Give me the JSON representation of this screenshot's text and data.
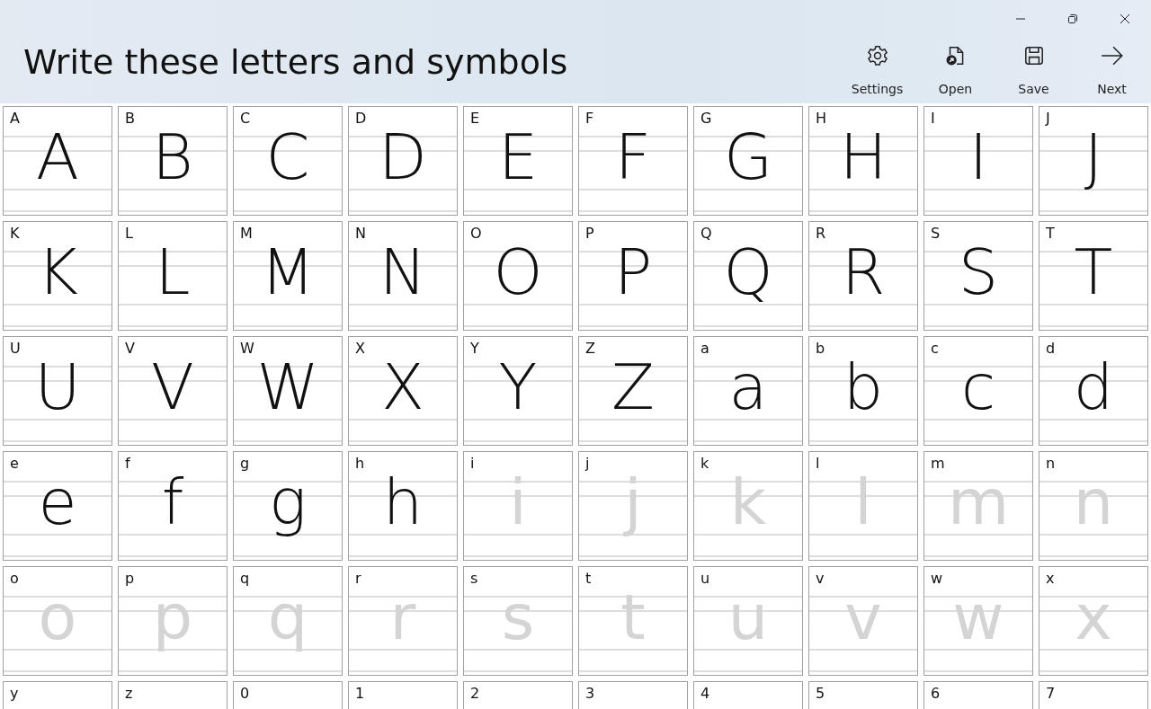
{
  "window": {
    "title": "Write these letters and symbols"
  },
  "toolbar": [
    {
      "kind": "settings",
      "label": "Settings"
    },
    {
      "kind": "open",
      "label": "Open"
    },
    {
      "kind": "save",
      "label": "Save"
    },
    {
      "kind": "next",
      "label": "Next"
    }
  ],
  "cells": [
    {
      "label": "A",
      "glyph": "A",
      "written": true
    },
    {
      "label": "B",
      "glyph": "B",
      "written": true
    },
    {
      "label": "C",
      "glyph": "C",
      "written": true
    },
    {
      "label": "D",
      "glyph": "D",
      "written": true
    },
    {
      "label": "E",
      "glyph": "E",
      "written": true
    },
    {
      "label": "F",
      "glyph": "F",
      "written": true
    },
    {
      "label": "G",
      "glyph": "G",
      "written": true
    },
    {
      "label": "H",
      "glyph": "H",
      "written": true
    },
    {
      "label": "I",
      "glyph": "I",
      "written": true
    },
    {
      "label": "J",
      "glyph": "J",
      "written": true
    },
    {
      "label": "K",
      "glyph": "K",
      "written": true
    },
    {
      "label": "L",
      "glyph": "L",
      "written": true
    },
    {
      "label": "M",
      "glyph": "M",
      "written": true
    },
    {
      "label": "N",
      "glyph": "N",
      "written": true
    },
    {
      "label": "O",
      "glyph": "O",
      "written": true
    },
    {
      "label": "P",
      "glyph": "P",
      "written": true
    },
    {
      "label": "Q",
      "glyph": "Q",
      "written": true
    },
    {
      "label": "R",
      "glyph": "R",
      "written": true
    },
    {
      "label": "S",
      "glyph": "S",
      "written": true
    },
    {
      "label": "T",
      "glyph": "T",
      "written": true
    },
    {
      "label": "U",
      "glyph": "U",
      "written": true
    },
    {
      "label": "V",
      "glyph": "V",
      "written": true
    },
    {
      "label": "W",
      "glyph": "W",
      "written": true
    },
    {
      "label": "X",
      "glyph": "X",
      "written": true
    },
    {
      "label": "Y",
      "glyph": "Y",
      "written": true
    },
    {
      "label": "Z",
      "glyph": "Z",
      "written": true
    },
    {
      "label": "a",
      "glyph": "a",
      "written": true
    },
    {
      "label": "b",
      "glyph": "b",
      "written": true
    },
    {
      "label": "c",
      "glyph": "c",
      "written": true
    },
    {
      "label": "d",
      "glyph": "d",
      "written": true
    },
    {
      "label": "e",
      "glyph": "e",
      "written": true
    },
    {
      "label": "f",
      "glyph": "f",
      "written": true
    },
    {
      "label": "g",
      "glyph": "g",
      "written": true
    },
    {
      "label": "h",
      "glyph": "h",
      "written": true
    },
    {
      "label": "i",
      "glyph": "i",
      "written": false
    },
    {
      "label": "j",
      "glyph": "j",
      "written": false
    },
    {
      "label": "k",
      "glyph": "k",
      "written": false
    },
    {
      "label": "l",
      "glyph": "l",
      "written": false
    },
    {
      "label": "m",
      "glyph": "m",
      "written": false
    },
    {
      "label": "n",
      "glyph": "n",
      "written": false
    },
    {
      "label": "o",
      "glyph": "o",
      "written": false
    },
    {
      "label": "p",
      "glyph": "p",
      "written": false
    },
    {
      "label": "q",
      "glyph": "q",
      "written": false
    },
    {
      "label": "r",
      "glyph": "r",
      "written": false
    },
    {
      "label": "s",
      "glyph": "s",
      "written": false
    },
    {
      "label": "t",
      "glyph": "t",
      "written": false
    },
    {
      "label": "u",
      "glyph": "u",
      "written": false
    },
    {
      "label": "v",
      "glyph": "v",
      "written": false
    },
    {
      "label": "w",
      "glyph": "w",
      "written": false
    },
    {
      "label": "x",
      "glyph": "x",
      "written": false
    },
    {
      "label": "y"
    },
    {
      "label": "z"
    },
    {
      "label": "0"
    },
    {
      "label": "1"
    },
    {
      "label": "2"
    },
    {
      "label": "3"
    },
    {
      "label": "4"
    },
    {
      "label": "5"
    },
    {
      "label": "6"
    },
    {
      "label": "7"
    }
  ]
}
